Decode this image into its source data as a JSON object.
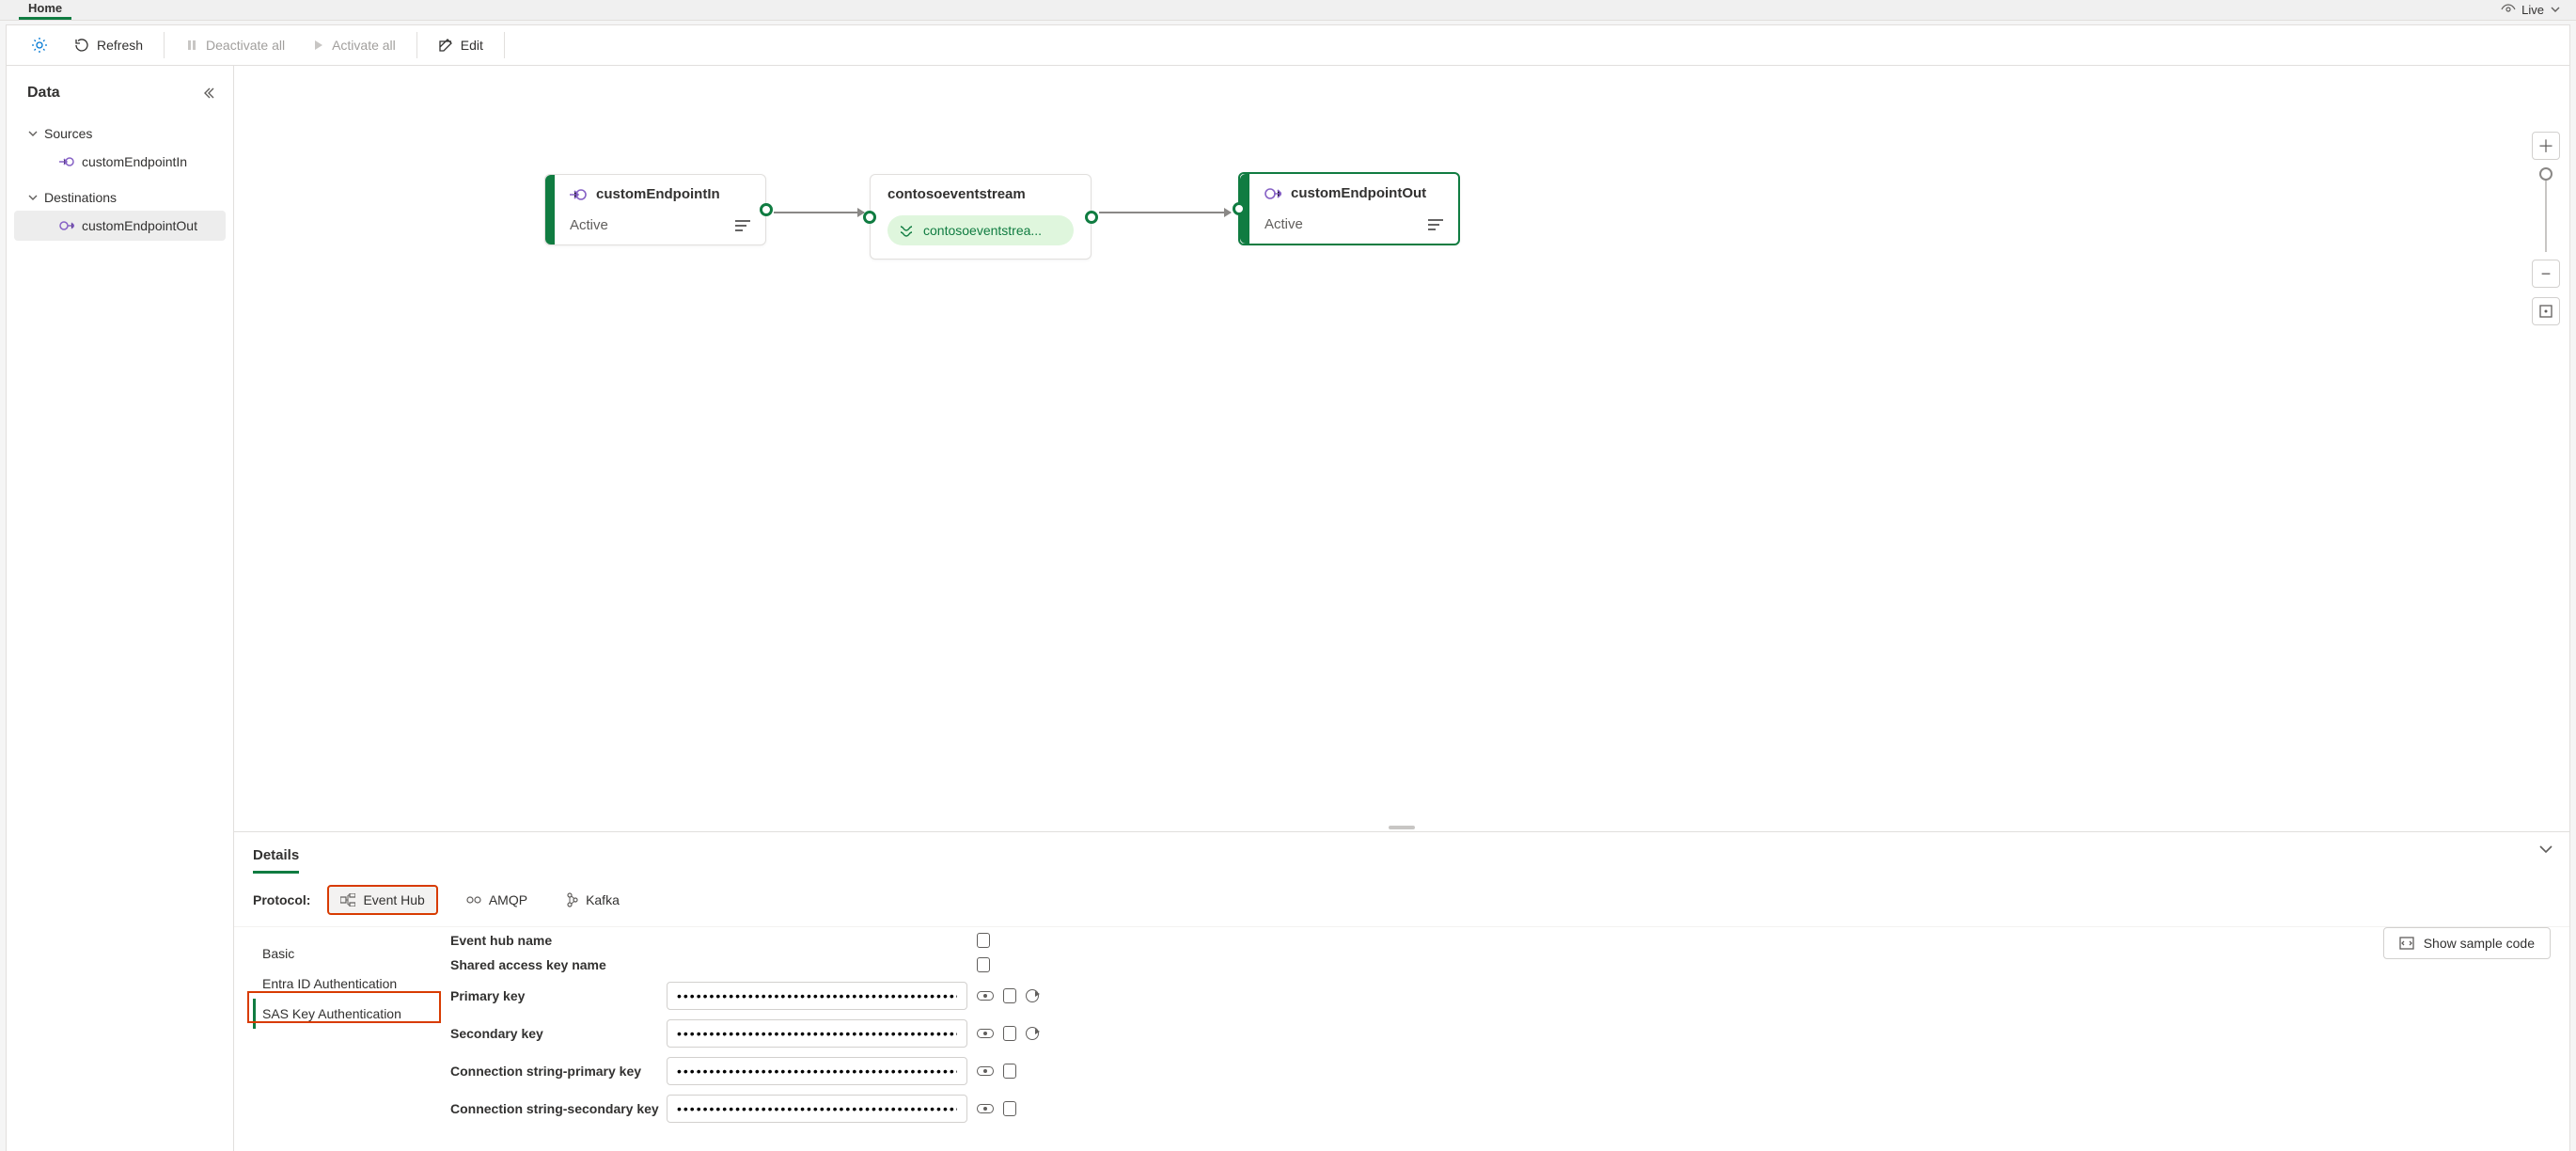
{
  "tabs": {
    "home": "Home"
  },
  "live": {
    "label": "Live"
  },
  "toolbar": {
    "refresh": "Refresh",
    "deactivate": "Deactivate all",
    "activate": "Activate all",
    "edit": "Edit"
  },
  "sidebar": {
    "title": "Data",
    "groups": {
      "sources": {
        "label": "Sources",
        "items": [
          "customEndpointIn"
        ]
      },
      "destinations": {
        "label": "Destinations",
        "items": [
          "customEndpointOut"
        ]
      }
    }
  },
  "nodes": {
    "source": {
      "title": "customEndpointIn",
      "status": "Active"
    },
    "center": {
      "title": "contosoeventstream",
      "pill": "contosoeventstrea..."
    },
    "dest": {
      "title": "customEndpointOut",
      "status": "Active"
    }
  },
  "details": {
    "tab": "Details",
    "protocol_label": "Protocol:",
    "protocols": {
      "eventhub": "Event Hub",
      "amqp": "AMQP",
      "kafka": "Kafka"
    },
    "nav": {
      "basic": "Basic",
      "entra": "Entra ID Authentication",
      "sas": "SAS Key Authentication"
    },
    "show_sample": "Show sample code",
    "fields": {
      "eventhub_name": "Event hub name",
      "sak_name": "Shared access key name",
      "primary": "Primary key",
      "secondary": "Secondary key",
      "conn_primary": "Connection string-primary key",
      "conn_secondary": "Connection string-secondary key"
    },
    "masked": "••••••••••••••••••••••••••••••••••••••••••••••"
  }
}
